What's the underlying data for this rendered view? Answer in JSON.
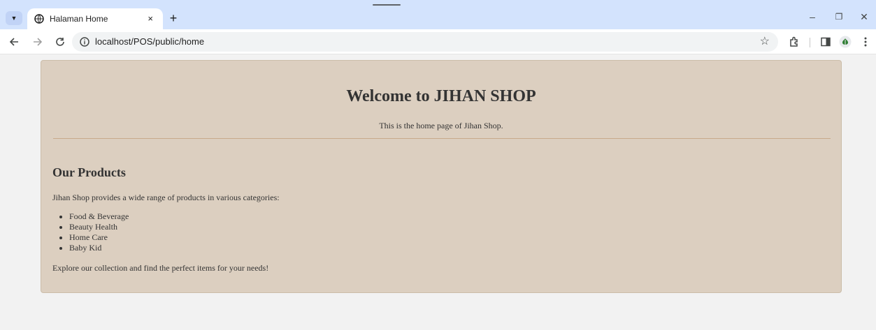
{
  "browser": {
    "tab": {
      "title": "Halaman Home",
      "close": "×"
    },
    "new_tab": "+",
    "window_controls": {
      "minimize": "–",
      "restore": "❐",
      "close": "✕"
    },
    "address_bar": {
      "url": "localhost/POS/public/home"
    },
    "icons": [
      "tab-list-icon",
      "favicon-icon",
      "back-icon",
      "forward-icon",
      "reload-icon",
      "site-info-icon",
      "bookmark-star-icon",
      "extensions-icon",
      "side-panel-icon",
      "profile-icon",
      "menu-icon"
    ]
  },
  "page": {
    "title": "Welcome to JIHAN SHOP",
    "subtitle": "This is the home page of Jihan Shop.",
    "products": {
      "heading": "Our Products",
      "intro": "Jihan Shop provides a wide range of products in various categories:",
      "categories": [
        "Food & Beverage",
        "Beauty Health",
        "Home Care",
        "Baby Kid"
      ],
      "closing": "Explore our collection and find the perfect items for your needs!"
    }
  },
  "colors": {
    "tab_strip": "#d3e3fd",
    "card_background": "#dccfc0",
    "divider": "#c8a98a",
    "page_background": "#f2f2f2",
    "text": "#333333"
  }
}
